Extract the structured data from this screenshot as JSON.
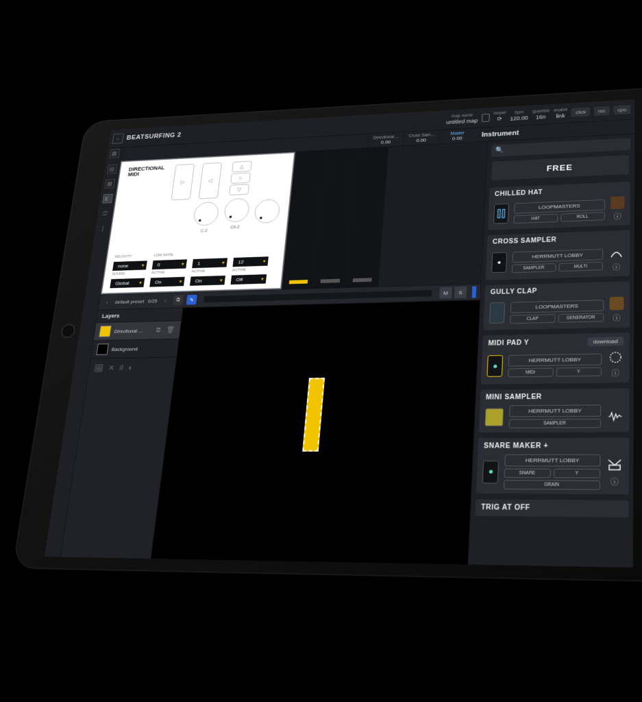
{
  "app": {
    "title": "BEATSURFING 2"
  },
  "topbar": {
    "map_label": "map name",
    "map_value": "untitled map",
    "looper_label": "looper",
    "bpm_label": "bpm",
    "bpm_value": "120.00",
    "quantize_label": "quantize",
    "quantize_value": "16n",
    "enable_label": "enable",
    "enable_value": "link",
    "click": "click",
    "rec": "rec",
    "cpu": "cpu"
  },
  "meters": {
    "m1_name": "Directional ...",
    "m1_val": "0.00",
    "m2_name": "Cross Sam...",
    "m2_val": "0.00",
    "m3_name": "Master",
    "m3_val": "0.00"
  },
  "sidebar_title": "Instrument",
  "whitepanel": {
    "brand_top": "DIRECTIONAL",
    "brand_bot": "MIDI",
    "knob1": "C-2",
    "knob2": "C#-2",
    "row1": {
      "label": "VELOCITY",
      "v1": "none",
      "nlabel": "LOW NOTE",
      "v2": "0",
      "v3": "1",
      "v4": "12"
    },
    "row2": {
      "label": "SOUND",
      "v1": "Global",
      "v2": "On",
      "a": "ACTIVE",
      "v3": "On",
      "v4": "Off"
    }
  },
  "preset": {
    "name": "default preset",
    "count": "0/25",
    "m": "M",
    "s": "S"
  },
  "layers": {
    "title": "Layers",
    "l1": "Directional ...",
    "l2": "Background"
  },
  "right": {
    "free": "FREE",
    "c1": {
      "title": "CHILLED HAT",
      "maker": "LOOPMASTERS",
      "t1": "HAT",
      "t2": "ROLL"
    },
    "c2": {
      "title": "CROSS SAMPLER",
      "maker": "HERRMUTT LOBBY",
      "t1": "SAMPLER",
      "t2": "MULTI"
    },
    "c3": {
      "title": "GULLY CLAP",
      "maker": "LOOPMASTERS",
      "t1": "CLAP",
      "t2": "GENERATOR"
    },
    "c4": {
      "title": "MIDI PAD Y",
      "maker": "HERRMUTT LOBBY",
      "t1": "MIDI",
      "t2": "Y",
      "dl": "download"
    },
    "c5": {
      "title": "MINI SAMPLER",
      "maker": "HERRMUTT LOBBY",
      "t1": "SAMPLER"
    },
    "c6": {
      "title": "SNARE MAKER +",
      "maker": "HERRMUTT LOBBY",
      "t1": "SNARE",
      "t2": "Y",
      "t3": "GRAIN"
    },
    "c7": {
      "title": "TRIG AT OFF"
    }
  }
}
